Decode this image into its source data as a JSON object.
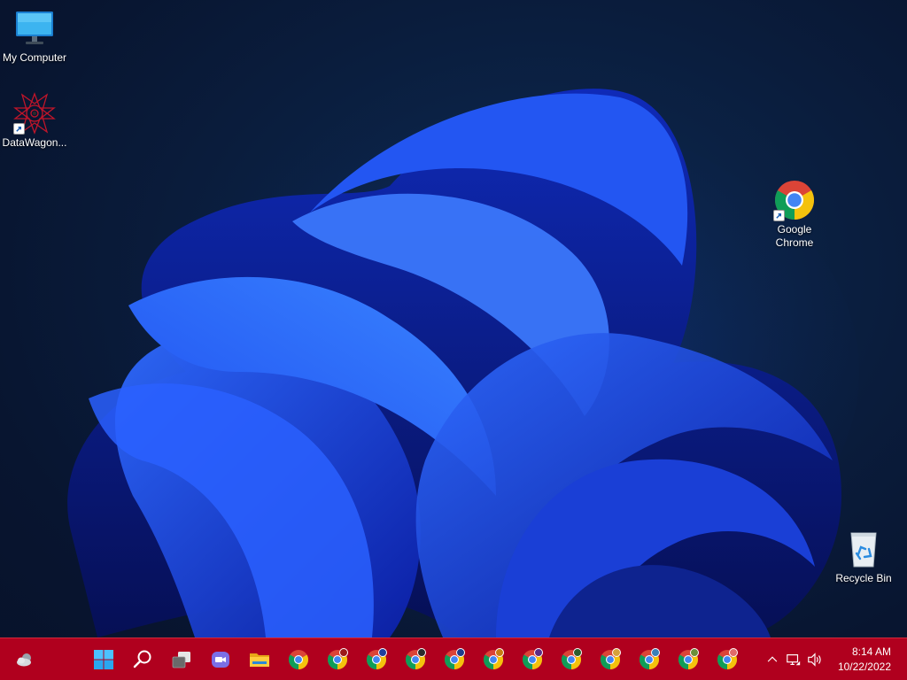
{
  "desktop": {
    "icons": [
      {
        "label": "My Computer",
        "icon": "monitor-icon"
      },
      {
        "label": "DataWagon...",
        "icon": "datawagon-logo-icon",
        "shortcut": true
      },
      {
        "label": "Google Chrome",
        "icon": "chrome-icon",
        "shortcut": true
      },
      {
        "label": "Recycle Bin",
        "icon": "recycle-bin-icon"
      }
    ]
  },
  "taskbar": {
    "background": "#b0001e",
    "widgets": {
      "icon": "weather-cloud-icon"
    },
    "pinned": [
      {
        "icon": "windows-start-icon"
      },
      {
        "icon": "search-icon"
      },
      {
        "icon": "task-view-icon"
      },
      {
        "icon": "teams-chat-icon"
      },
      {
        "icon": "file-explorer-icon"
      },
      {
        "icon": "chrome-icon"
      },
      {
        "icon": "chrome-profile-icon",
        "badge": "#9b1a1a"
      },
      {
        "icon": "chrome-profile-icon",
        "badge": "#1f3f9e"
      },
      {
        "icon": "chrome-profile-icon",
        "badge": "#2b2b2b"
      },
      {
        "icon": "chrome-profile-icon",
        "badge": "#1d3c8c"
      },
      {
        "icon": "chrome-profile-icon",
        "badge": "#c77a12"
      },
      {
        "icon": "chrome-profile-icon",
        "badge": "#5b2a86"
      },
      {
        "icon": "chrome-profile-icon",
        "badge": "#2d5d2d"
      },
      {
        "icon": "chrome-profile-icon",
        "badge": "#d8a13a"
      },
      {
        "icon": "chrome-profile-icon",
        "badge": "#3a7fb8"
      },
      {
        "icon": "chrome-profile-icon",
        "badge": "#6a8f3a"
      },
      {
        "icon": "chrome-profile-icon",
        "badge": "#e06a6a"
      }
    ],
    "tray": {
      "chevron": "chevron-up-icon",
      "network": "network-icon",
      "volume": "volume-icon",
      "time": "8:14 AM",
      "date": "10/22/2022"
    }
  }
}
